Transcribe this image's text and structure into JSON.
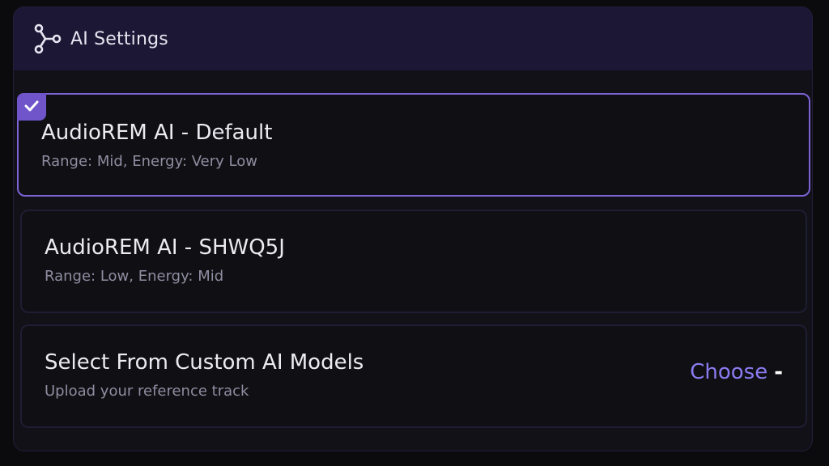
{
  "header": {
    "title": "AI Settings",
    "icon": "network-nodes-icon"
  },
  "options": [
    {
      "title": "AudioREM AI - Default",
      "subtitle": "Range: Mid, Energy: Very Low",
      "selected": true
    },
    {
      "title": "AudioREM AI - SHWQ5J",
      "subtitle": "Range: Low, Energy: Mid",
      "selected": false
    },
    {
      "title": "Select From Custom AI Models",
      "subtitle": "Upload your reference track",
      "action_label": "Choose",
      "action_suffix": "-"
    }
  ],
  "colors": {
    "accent": "#7c63d6",
    "header_bg": "#1b1735",
    "link": "#8a7cf0"
  }
}
